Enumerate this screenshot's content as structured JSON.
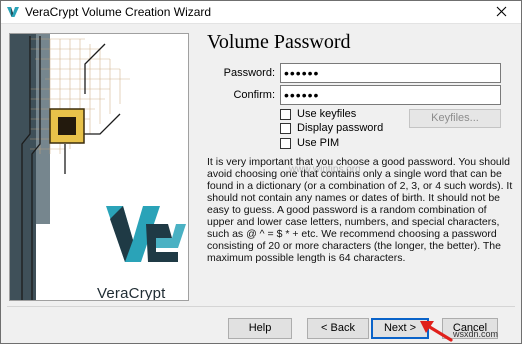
{
  "window": {
    "title": "VeraCrypt Volume Creation Wizard"
  },
  "banner": {
    "brand": "VeraCrypt"
  },
  "page": {
    "heading": "Volume Password",
    "password_label": "Password:",
    "password_value": "••••••",
    "confirm_label": "Confirm:",
    "confirm_value": "••••••"
  },
  "options": [
    {
      "label": "Use keyfiles",
      "checked": false
    },
    {
      "label": "Display password",
      "checked": false
    },
    {
      "label": "Use PIM",
      "checked": false
    }
  ],
  "keyfiles_button": "Keyfiles...",
  "info_text": "It is very important that you choose a good password. You should avoid choosing one that contains only a single word that can be found in a dictionary (or a combination of 2, 3, or 4 such words). It should not contain any names or dates of birth. It should not be easy to guess. A good password is a random combination of upper and lower case letters, numbers, and special characters, such as @ ^ = $ * + etc. We recommend choosing a password consisting of 20 or more characters (the longer, the better). The maximum possible length is 64 characters.",
  "watermark": "www.wintips.org",
  "buttons": {
    "help": "Help",
    "back": "< Back",
    "next": "Next >",
    "cancel": "Cancel"
  },
  "corner_mark": "wsxdn.com",
  "colors": {
    "accent_blue": "#0a63c9",
    "brand_teal": "#2aa3b8",
    "brand_dark": "#1f3a45",
    "arrow_red": "#e0201b"
  }
}
